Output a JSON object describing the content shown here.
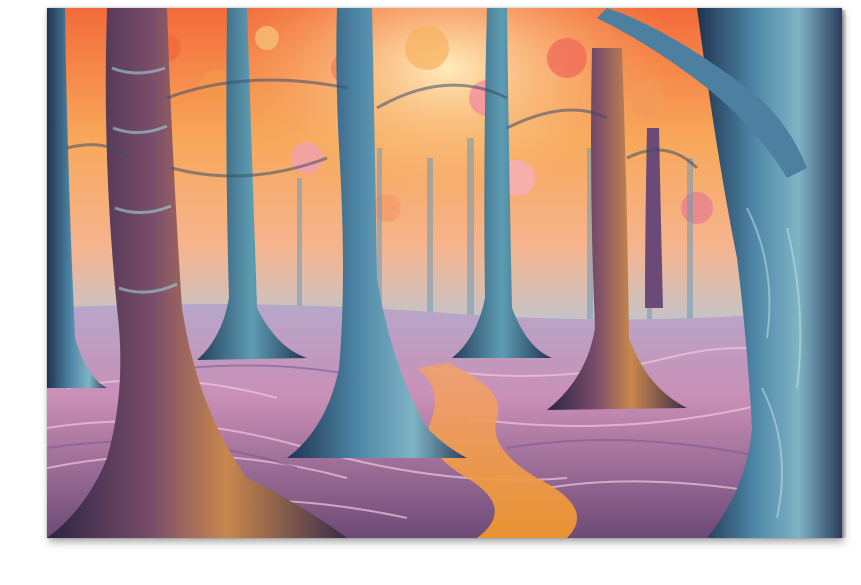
{
  "artwork": {
    "subject": "forest-at-sunset",
    "colors": {
      "sky_warm": "#f7a85a",
      "sky_pink": "#f08aa8",
      "sky_glow": "#fde2a8",
      "trunk_blue": "#3a5f8a",
      "trunk_teal": "#5fa3b8",
      "trunk_dark": "#2b2e4a",
      "ground_pink": "#e6a7c7",
      "ground_mauve": "#9a6f9e",
      "path_glow": "#f5a23a"
    }
  }
}
